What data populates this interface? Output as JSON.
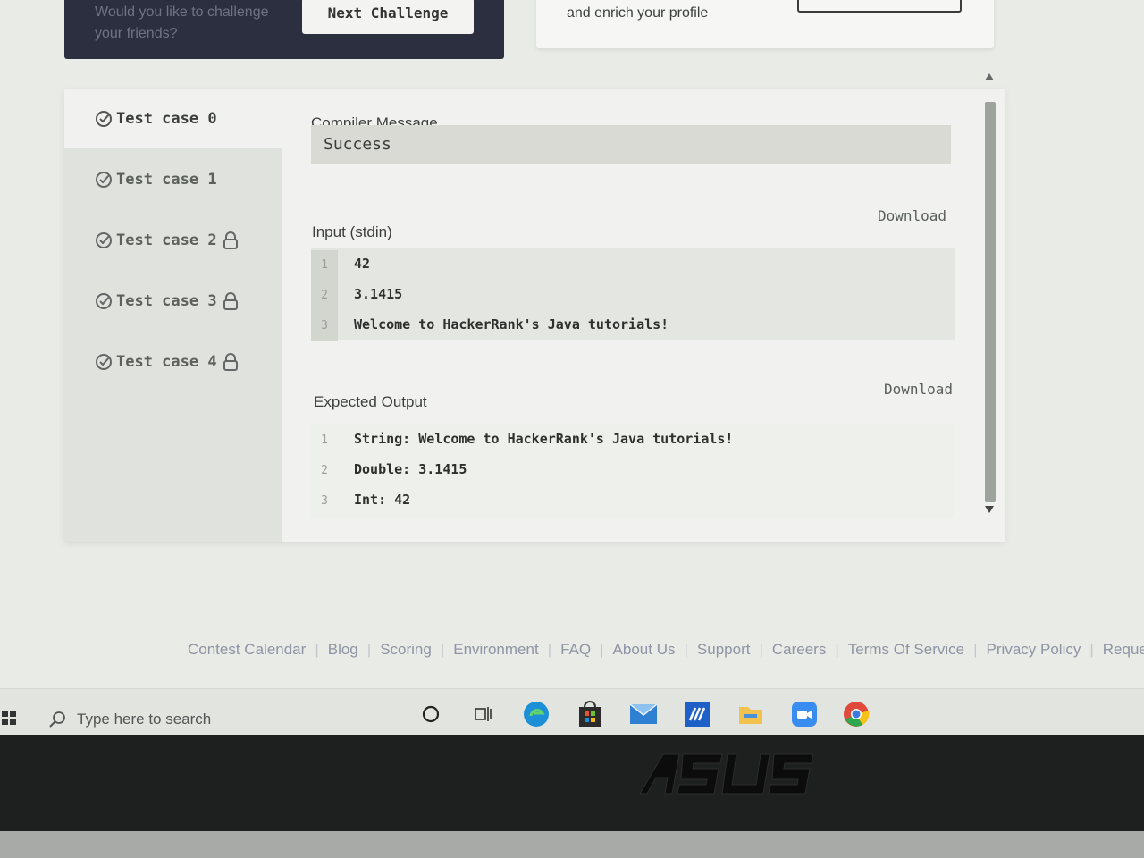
{
  "promo": {
    "challenge_text": "Would you like to challenge your friends?",
    "next_button": "Next Challenge",
    "profile_text": "and enrich your profile"
  },
  "tabs": [
    {
      "label": "Test case 0",
      "locked": false,
      "passed": true,
      "active": true
    },
    {
      "label": "Test case 1",
      "locked": false,
      "passed": true,
      "active": false
    },
    {
      "label": "Test case 2",
      "locked": true,
      "passed": true,
      "active": false
    },
    {
      "label": "Test case 3",
      "locked": true,
      "passed": true,
      "active": false
    },
    {
      "label": "Test case 4",
      "locked": true,
      "passed": true,
      "active": false
    }
  ],
  "compiler": {
    "label": "Compiler Message",
    "message": "Success"
  },
  "input": {
    "label": "Input (stdin)",
    "download": "Download",
    "lines": [
      {
        "n": "1",
        "text": "42"
      },
      {
        "n": "2",
        "text": "3.1415"
      },
      {
        "n": "3",
        "text": "Welcome to HackerRank's Java tutorials!"
      }
    ]
  },
  "expected": {
    "label": "Expected Output",
    "download": "Download",
    "lines": [
      {
        "n": "1",
        "text": "String: Welcome to HackerRank's Java tutorials!"
      },
      {
        "n": "2",
        "text": "Double: 3.1415"
      },
      {
        "n": "3",
        "text": "Int: 42"
      }
    ]
  },
  "footer": {
    "links": [
      "Contest Calendar",
      "Blog",
      "Scoring",
      "Environment",
      "FAQ",
      "About Us",
      "Support",
      "Careers",
      "Terms Of Service",
      "Privacy Policy",
      "Reques"
    ]
  },
  "taskbar": {
    "search_placeholder": "Type here to search",
    "icons": [
      "cortana-icon",
      "task-view-icon",
      "edge-icon",
      "store-icon",
      "mail-icon",
      "app-icon",
      "file-explorer-icon",
      "zoom-icon",
      "chrome-icon"
    ]
  },
  "colors": {
    "panel": "#f1f2ef",
    "tabs_bg": "#e0e2dd",
    "success_box": "#d8dad3",
    "footer_link": "#8e94a4",
    "dark_card": "#2b2f3f"
  }
}
